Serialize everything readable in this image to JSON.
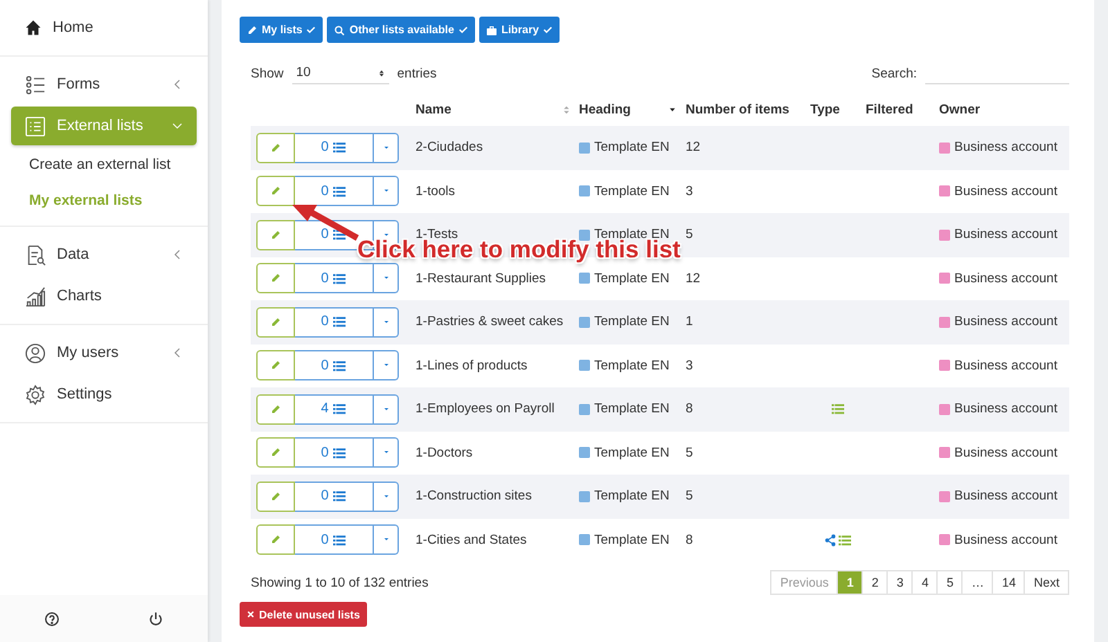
{
  "sidebar": {
    "groups": [
      {
        "items": [
          {
            "label": "Home",
            "selected": false
          }
        ]
      },
      {
        "items": [
          {
            "label": "Forms",
            "selected": false,
            "expanded": false
          },
          {
            "label": "External lists",
            "selected": true,
            "expanded": true,
            "children": [
              {
                "label": "Create an external list",
                "selected": false
              },
              {
                "label": "My external lists",
                "selected": true
              }
            ]
          }
        ]
      },
      {
        "items": [
          {
            "label": "Data",
            "selected": false,
            "expanded": false
          },
          {
            "label": "Charts",
            "selected": false
          }
        ]
      },
      {
        "items": [
          {
            "label": "My users",
            "selected": false,
            "expanded": false
          },
          {
            "label": "Settings",
            "selected": false
          }
        ]
      }
    ]
  },
  "filters": [
    {
      "label": "My lists",
      "checked": true
    },
    {
      "label": "Other lists available",
      "checked": true
    },
    {
      "label": "Library",
      "checked": true
    }
  ],
  "length": {
    "before": "Show",
    "value": "10",
    "after": "entries"
  },
  "search": {
    "label": "Search:"
  },
  "table": {
    "columns": [
      {
        "label": "Name"
      },
      {
        "label": "Heading"
      },
      {
        "label": "Number of items"
      },
      {
        "label": "Type"
      },
      {
        "label": "Filtered"
      },
      {
        "label": "Owner"
      }
    ],
    "rows": [
      {
        "count": "0",
        "name": "2-Ciudades",
        "heading": "Template EN",
        "items": "12",
        "type": [],
        "owner": "Business account"
      },
      {
        "count": "0",
        "name": "1-tools",
        "heading": "Template EN",
        "items": "3",
        "type": [],
        "owner": "Business account"
      },
      {
        "count": "0",
        "name": "1-Tests",
        "heading": "Template EN",
        "items": "5",
        "type": [],
        "owner": "Business account"
      },
      {
        "count": "0",
        "name": "1-Restaurant Supplies",
        "heading": "Template EN",
        "items": "12",
        "type": [],
        "owner": "Business account"
      },
      {
        "count": "0",
        "name": "1-Pastries & sweet cakes",
        "heading": "Template EN",
        "items": "1",
        "type": [],
        "owner": "Business account"
      },
      {
        "count": "0",
        "name": "1-Lines of products",
        "heading": "Template EN",
        "items": "3",
        "type": [],
        "owner": "Business account"
      },
      {
        "count": "4",
        "name": "1-Employees on Payroll",
        "heading": "Template EN",
        "items": "8",
        "type": [
          {
            "kind": "list"
          }
        ],
        "owner": "Business account"
      },
      {
        "count": "0",
        "name": "1-Doctors",
        "heading": "Template EN",
        "items": "5",
        "type": [],
        "owner": "Business account"
      },
      {
        "count": "0",
        "name": "1-Construction sites",
        "heading": "Template EN",
        "items": "5",
        "type": [],
        "owner": "Business account"
      },
      {
        "count": "0",
        "name": "1-Cities and States",
        "heading": "Template EN",
        "items": "8",
        "type": [
          {
            "kind": "share"
          },
          {
            "kind": "list"
          }
        ],
        "owner": "Business account"
      }
    ]
  },
  "info": "Showing 1 to 10 of 132 entries",
  "pagination": [
    {
      "label": "Previous",
      "selected": false,
      "disabled": true
    },
    {
      "label": "1",
      "selected": true,
      "disabled": false
    },
    {
      "label": "2",
      "selected": false,
      "disabled": false
    },
    {
      "label": "3",
      "selected": false,
      "disabled": false
    },
    {
      "label": "4",
      "selected": false,
      "disabled": false
    },
    {
      "label": "5",
      "selected": false,
      "disabled": false
    },
    {
      "label": "…",
      "selected": false,
      "disabled": false
    },
    {
      "label": "14",
      "selected": false,
      "disabled": false
    },
    {
      "label": "Next",
      "selected": false,
      "disabled": false
    }
  ],
  "delete_button": "Delete unused lists",
  "annotation": {
    "text": "Click here to modify this list"
  }
}
